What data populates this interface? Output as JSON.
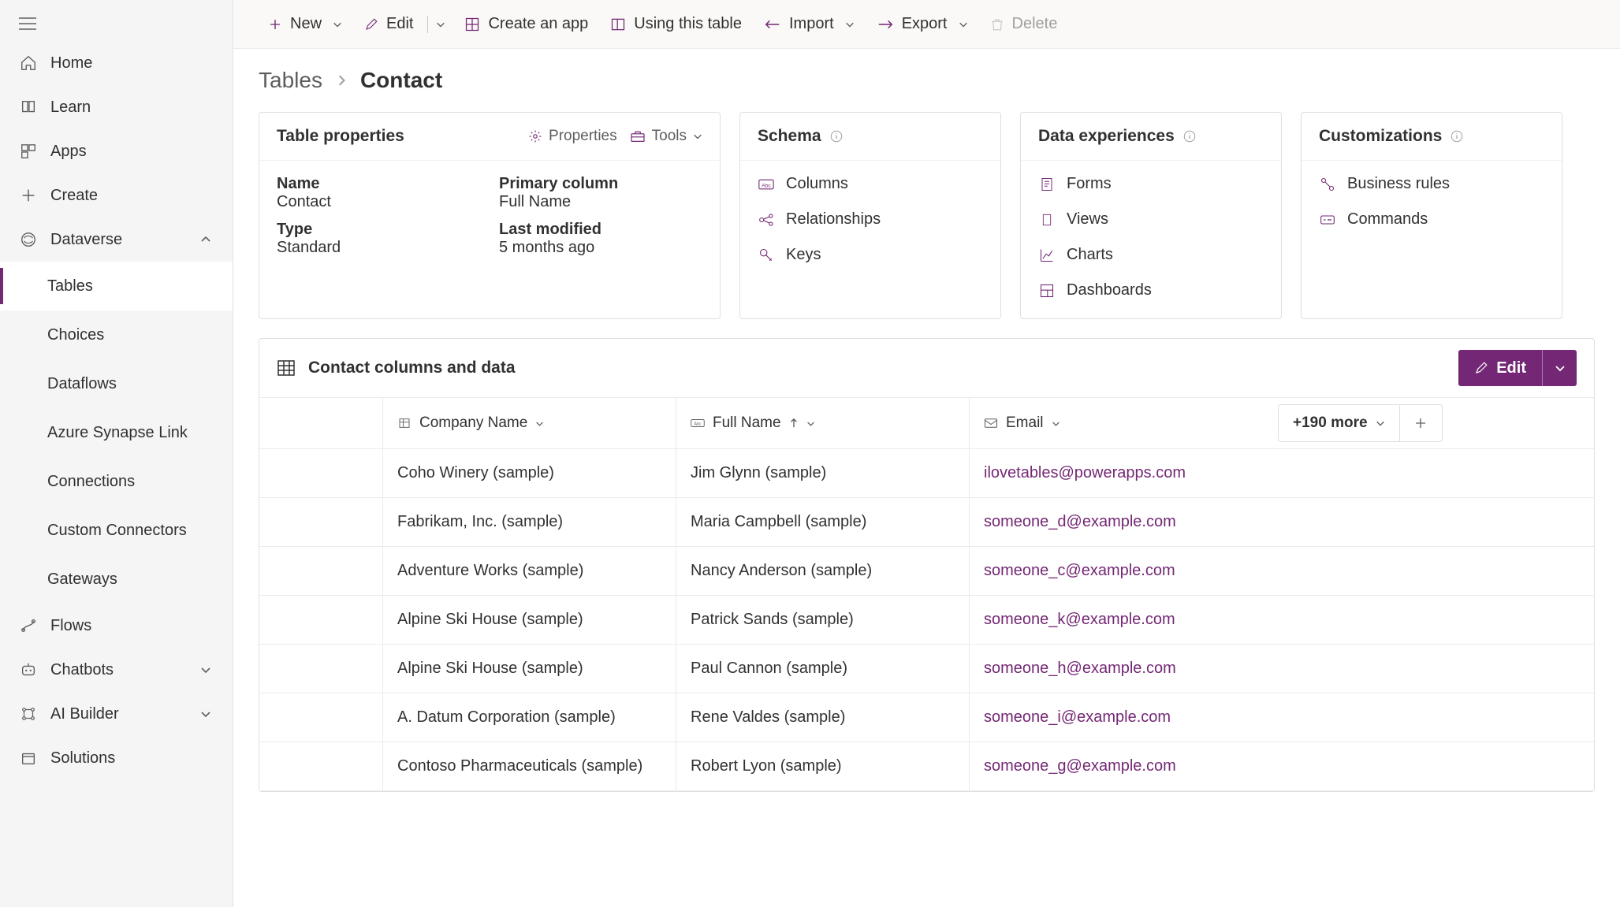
{
  "sidebar": {
    "items": [
      {
        "label": "Home"
      },
      {
        "label": "Learn"
      },
      {
        "label": "Apps"
      },
      {
        "label": "Create"
      },
      {
        "label": "Dataverse",
        "expanded": true,
        "children": [
          {
            "label": "Tables",
            "active": true
          },
          {
            "label": "Choices"
          },
          {
            "label": "Dataflows"
          },
          {
            "label": "Azure Synapse Link"
          },
          {
            "label": "Connections"
          },
          {
            "label": "Custom Connectors"
          },
          {
            "label": "Gateways"
          }
        ]
      },
      {
        "label": "Flows"
      },
      {
        "label": "Chatbots",
        "expandable": true
      },
      {
        "label": "AI Builder",
        "expandable": true
      },
      {
        "label": "Solutions"
      }
    ]
  },
  "toolbar": {
    "new": "New",
    "edit": "Edit",
    "createApp": "Create an app",
    "usingTable": "Using this table",
    "import": "Import",
    "export": "Export",
    "delete": "Delete"
  },
  "breadcrumb": {
    "root": "Tables",
    "current": "Contact"
  },
  "card_properties": {
    "title": "Table properties",
    "action_properties": "Properties",
    "action_tools": "Tools",
    "name_label": "Name",
    "name_value": "Contact",
    "primary_label": "Primary column",
    "primary_value": "Full Name",
    "type_label": "Type",
    "type_value": "Standard",
    "modified_label": "Last modified",
    "modified_value": "5 months ago"
  },
  "card_schema": {
    "title": "Schema",
    "links": [
      "Columns",
      "Relationships",
      "Keys"
    ]
  },
  "card_dx": {
    "title": "Data experiences",
    "links": [
      "Forms",
      "Views",
      "Charts",
      "Dashboards"
    ]
  },
  "card_cust": {
    "title": "Customizations",
    "links": [
      "Business rules",
      "Commands"
    ]
  },
  "data_section": {
    "title": "Contact columns and data",
    "edit_label": "Edit",
    "more_label": "+190 more",
    "columns": {
      "company": "Company Name",
      "fullname": "Full Name",
      "email": "Email"
    },
    "rows": [
      {
        "company": "Coho Winery (sample)",
        "fullname": "Jim Glynn (sample)",
        "email": "ilovetables@powerapps.com"
      },
      {
        "company": "Fabrikam, Inc. (sample)",
        "fullname": "Maria Campbell (sample)",
        "email": "someone_d@example.com"
      },
      {
        "company": "Adventure Works (sample)",
        "fullname": "Nancy Anderson (sample)",
        "email": "someone_c@example.com"
      },
      {
        "company": "Alpine Ski House (sample)",
        "fullname": "Patrick Sands (sample)",
        "email": "someone_k@example.com"
      },
      {
        "company": "Alpine Ski House (sample)",
        "fullname": "Paul Cannon (sample)",
        "email": "someone_h@example.com"
      },
      {
        "company": "A. Datum Corporation (sample)",
        "fullname": "Rene Valdes (sample)",
        "email": "someone_i@example.com"
      },
      {
        "company": "Contoso Pharmaceuticals (sample)",
        "fullname": "Robert Lyon (sample)",
        "email": "someone_g@example.com"
      }
    ]
  }
}
